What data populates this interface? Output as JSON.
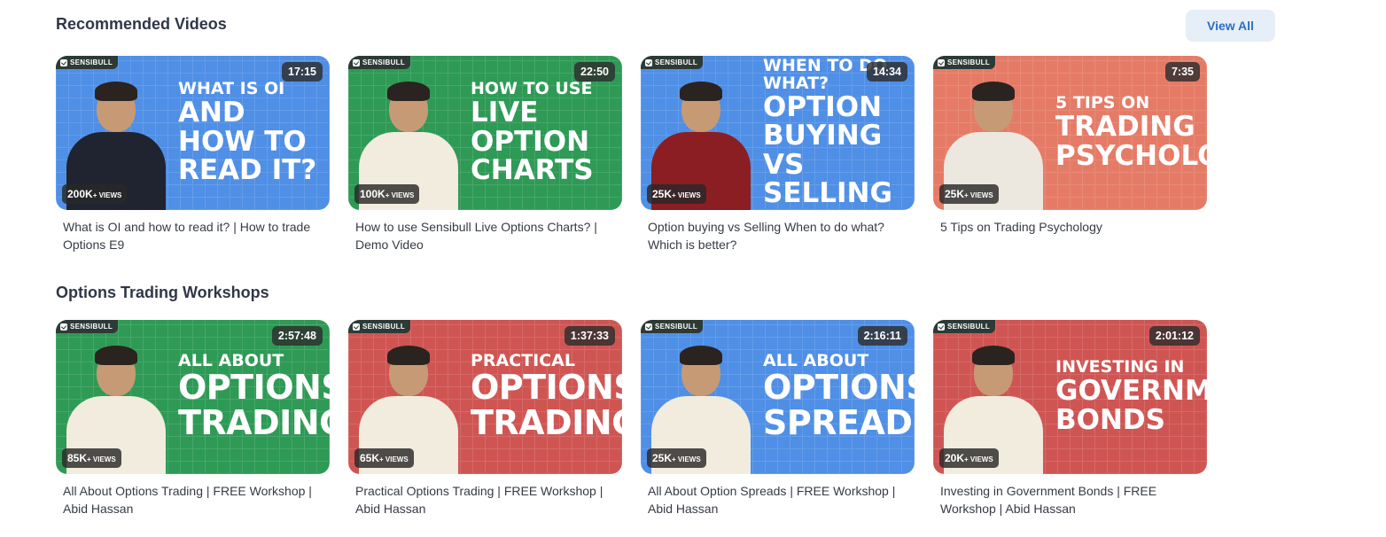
{
  "sections": [
    {
      "title": "Recommended Videos",
      "view_all": "View All",
      "videos": [
        {
          "duration": "17:15",
          "views": "200K",
          "views_unit": "+ VIEWS",
          "theme": "blue",
          "person": "dark",
          "thumb_small": "What is OI",
          "thumb_line2": "and how to read it?",
          "title": "What is OI and how to read it? | How to trade Options E9"
        },
        {
          "duration": "22:50",
          "views": "100K",
          "views_unit": "+ VIEWS",
          "theme": "green",
          "person": "light",
          "thumb_small": "How to use",
          "thumb_line2": "Live option charts",
          "title": "How to use Sensibull Live Options Charts? | Demo Video"
        },
        {
          "duration": "14:34",
          "views": "25K",
          "views_unit": "+ VIEWS",
          "theme": "blue",
          "person": "maroon",
          "thumb_small": "When to do what?",
          "thumb_line2": "Option buying vs selling",
          "title": "Option buying vs Selling When to do what? Which is better?"
        },
        {
          "duration": "7:35",
          "views": "25K",
          "views_unit": "+ VIEWS",
          "theme": "salmon",
          "person": "print",
          "thumb_small": "5 tips on",
          "thumb_line2": "Trading psychology",
          "title": "5 Tips on Trading Psychology"
        }
      ]
    },
    {
      "title": "Options Trading Workshops",
      "videos": [
        {
          "duration": "2:57:48",
          "views": "85K",
          "views_unit": "+ VIEWS",
          "theme": "green",
          "person": "light",
          "thumb_small": "All about",
          "thumb_line2": "Options trading",
          "title": "All About Options Trading | FREE Workshop | Abid Hassan"
        },
        {
          "duration": "1:37:33",
          "views": "65K",
          "views_unit": "+ VIEWS",
          "theme": "red",
          "person": "light",
          "thumb_small": "Practical",
          "thumb_line2": "Options trading",
          "title": "Practical Options Trading | FREE Workshop | Abid Hassan"
        },
        {
          "duration": "2:16:11",
          "views": "25K",
          "views_unit": "+ VIEWS",
          "theme": "blue",
          "person": "light",
          "thumb_small": "All about",
          "thumb_line2": "Options spreads",
          "title": "All About Option Spreads | FREE Workshop | Abid Hassan"
        },
        {
          "duration": "2:01:12",
          "views": "20K",
          "views_unit": "+ VIEWS",
          "theme": "red",
          "person": "light",
          "thumb_small": "Investing in",
          "thumb_line2": "Government bonds",
          "title": "Investing in Government Bonds | FREE Workshop | Abid Hassan"
        }
      ]
    }
  ],
  "brand_label": "SENSIBULL"
}
